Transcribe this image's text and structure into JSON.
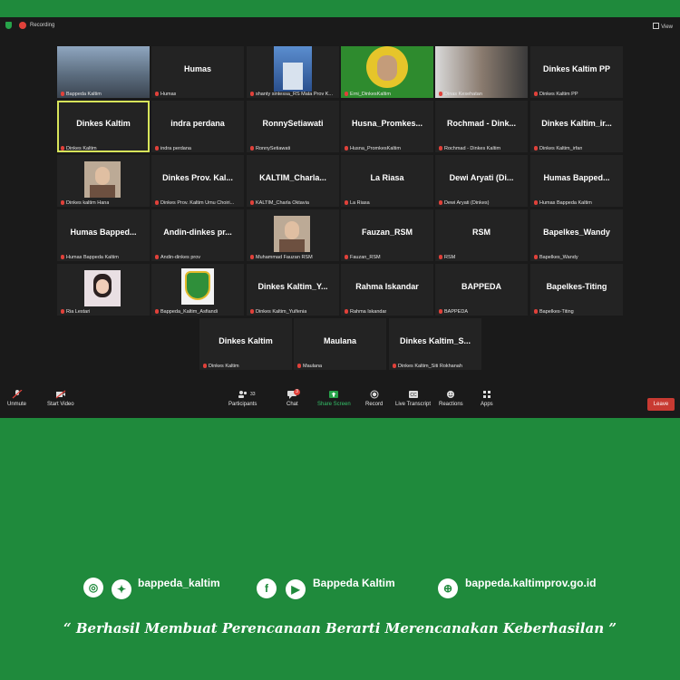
{
  "topbar": {
    "recording": "Recording",
    "view": "View"
  },
  "tiles": [
    {
      "name": "",
      "label": "Bappeda Kaltim"
    },
    {
      "name": "Humas",
      "label": "Humas"
    },
    {
      "name": "",
      "label": "shanty sintessa_RS Mata Prov K..."
    },
    {
      "name": "",
      "label": "Erni_DinkesKaltim"
    },
    {
      "name": "",
      "label": "Dinas Kesehatan"
    },
    {
      "name": "Dinkes Kaltim PP",
      "label": "Dinkes Kaltim PP"
    },
    {
      "name": "Dinkes Kaltim",
      "label": "Dinkes Kaltim"
    },
    {
      "name": "indra perdana",
      "label": "indra perdana"
    },
    {
      "name": "RonnySetiawati",
      "label": "RonnySetiawati"
    },
    {
      "name": "Husna_Promkes...",
      "label": "Husna_PromkesKaltim"
    },
    {
      "name": "Rochmad - Dink...",
      "label": "Rochmad - Dinkes Kaltim"
    },
    {
      "name": "Dinkes Kaltim_ir...",
      "label": "Dinkes Kaltim_irfan"
    },
    {
      "name": "",
      "label": "Dinkes kaltim Hana"
    },
    {
      "name": "Dinkes Prov. Kal...",
      "label": "Dinkes Prov. Kaltim Umu Choiri..."
    },
    {
      "name": "KALTIM_Charla...",
      "label": "KALTIM_Charla Oktavia"
    },
    {
      "name": "La Riasa",
      "label": "La Riasa"
    },
    {
      "name": "Dewi Aryati (Di...",
      "label": "Dewi Aryati (Dinkes)"
    },
    {
      "name": "Humas Bapped...",
      "label": "Humas Bappeda Kaltim"
    },
    {
      "name": "Humas Bapped...",
      "label": "Humas Bappeda Kaltim"
    },
    {
      "name": "Andin-dinkes pr...",
      "label": "Andin-dinkes prov"
    },
    {
      "name": "",
      "label": "Muhammad Fauzan RSM"
    },
    {
      "name": "Fauzan_RSM",
      "label": "Fauzan_RSM"
    },
    {
      "name": "RSM",
      "label": "RSM"
    },
    {
      "name": "Bapelkes_Wandy",
      "label": "Bapelkes_Wandy"
    },
    {
      "name": "",
      "label": "Ria Lestari"
    },
    {
      "name": "",
      "label": "Bappeda_Kaltim_Asfiandi"
    },
    {
      "name": "Dinkes Kaltim_Y...",
      "label": "Dinkes Kaltim_Yulfenia"
    },
    {
      "name": "Rahma Iskandar",
      "label": "Rahma Iskandar"
    },
    {
      "name": "BAPPEDA",
      "label": "BAPPEDA"
    },
    {
      "name": "Bapelkes-Titing",
      "label": "Bapelkes-Titing"
    },
    {
      "name": "Dinkes Kaltim",
      "label": "Dinkes Kaltim"
    },
    {
      "name": "Maulana",
      "label": "Maulana"
    },
    {
      "name": "Dinkes Kaltim_S...",
      "label": "Dinkes Kaltim_Siti Rokhanah"
    }
  ],
  "toolbar": {
    "unmute": "Unmute",
    "start_video": "Start Video",
    "participants": "Participants",
    "participants_count": "33",
    "chat": "Chat",
    "chat_badge": "3",
    "share_screen": "Share Screen",
    "record": "Record",
    "live_transcript": "Live Transcript",
    "reactions": "Reactions",
    "apps": "Apps",
    "leave": "Leave"
  },
  "footer": {
    "instagram_twitter_handle": "bappeda_kaltim",
    "facebook_youtube_handle": "Bappeda Kaltim",
    "website": "bappeda.kaltimprov.go.id",
    "motto": "“ Berhasil  Membuat Perencanaan Berarti Merencanakan Keberhasilan ”"
  },
  "colors": {
    "brand_green": "#1f8a3c",
    "zoom_bg": "#1a1a1a",
    "leave_red": "#c83a32",
    "active_outline": "#d7e45a"
  }
}
